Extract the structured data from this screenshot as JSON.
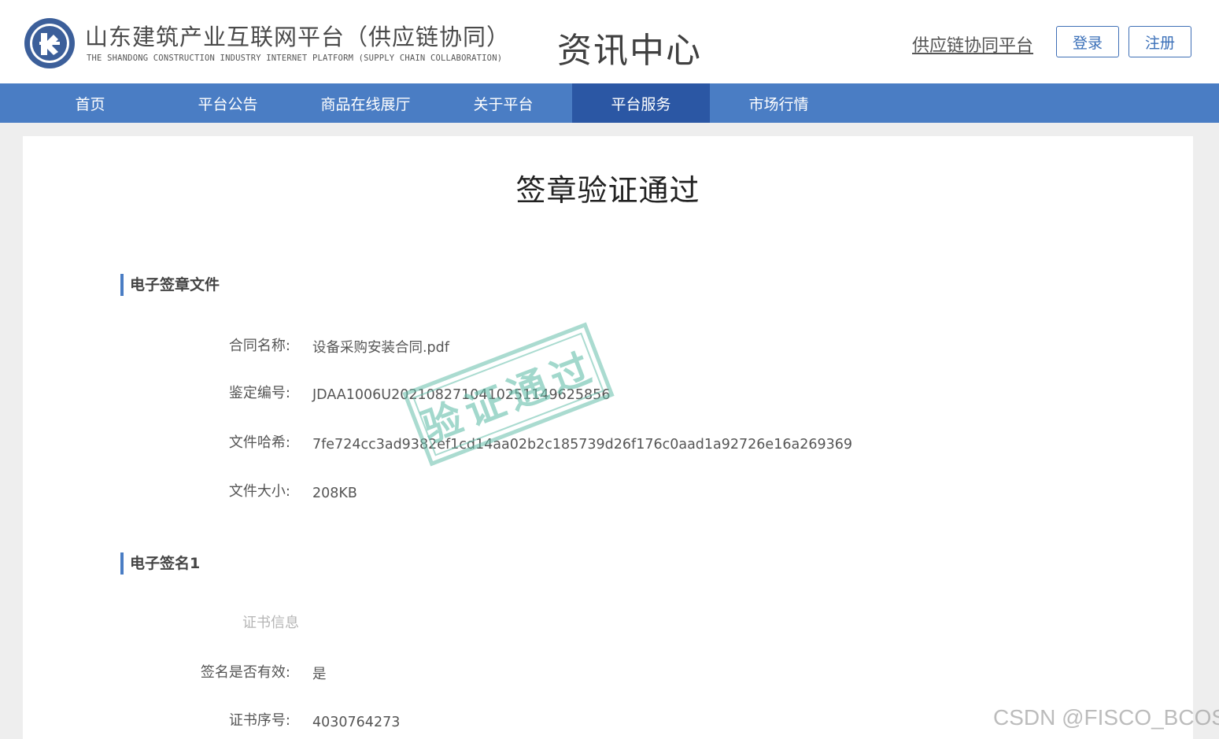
{
  "header": {
    "brand_title": "山东建筑产业互联网平台（供应链协同）",
    "brand_subtitle": "THE SHANDONG CONSTRUCTION INDUSTRY INTERNET PLATFORM  (SUPPLY CHAIN COLLABORATION)",
    "section_title": "资讯中心",
    "supply_link": "供应链协同平台",
    "login_label": "登录",
    "register_label": "注册"
  },
  "nav": {
    "items": [
      {
        "label": "首页"
      },
      {
        "label": "平台公告"
      },
      {
        "label": "商品在线展厅"
      },
      {
        "label": "关于平台"
      },
      {
        "label": "平台服务"
      },
      {
        "label": "市场行情"
      }
    ],
    "active": "平台服务"
  },
  "main": {
    "title": "签章验证通过",
    "stamp_text": "验证通过",
    "section_file": {
      "heading": "电子签章文件",
      "fields": [
        {
          "label": "合同名称:",
          "value": "设备采购安装合同.pdf"
        },
        {
          "label": "鉴定编号:",
          "value": "JDAA1006U20210827104102511496​25856"
        },
        {
          "label": "文件哈希:",
          "value": "7fe724cc3ad9382ef1cd14aa02b2c185739d26f176c0aad1a92726e16a269369"
        },
        {
          "label": "文件大小:",
          "value": "208KB"
        }
      ]
    },
    "section_sig": {
      "heading": "电子签名1",
      "subheading": "证书信息",
      "fields": [
        {
          "label": "签名是否有效:",
          "value": "是"
        },
        {
          "label": "证书序号:",
          "value": "4030764273"
        }
      ]
    }
  },
  "watermark": "CSDN @FISCO_BCOS",
  "colors": {
    "accent": "#4a7dc4",
    "nav_active": "#2b57a4",
    "stamp": "#64beaa"
  }
}
